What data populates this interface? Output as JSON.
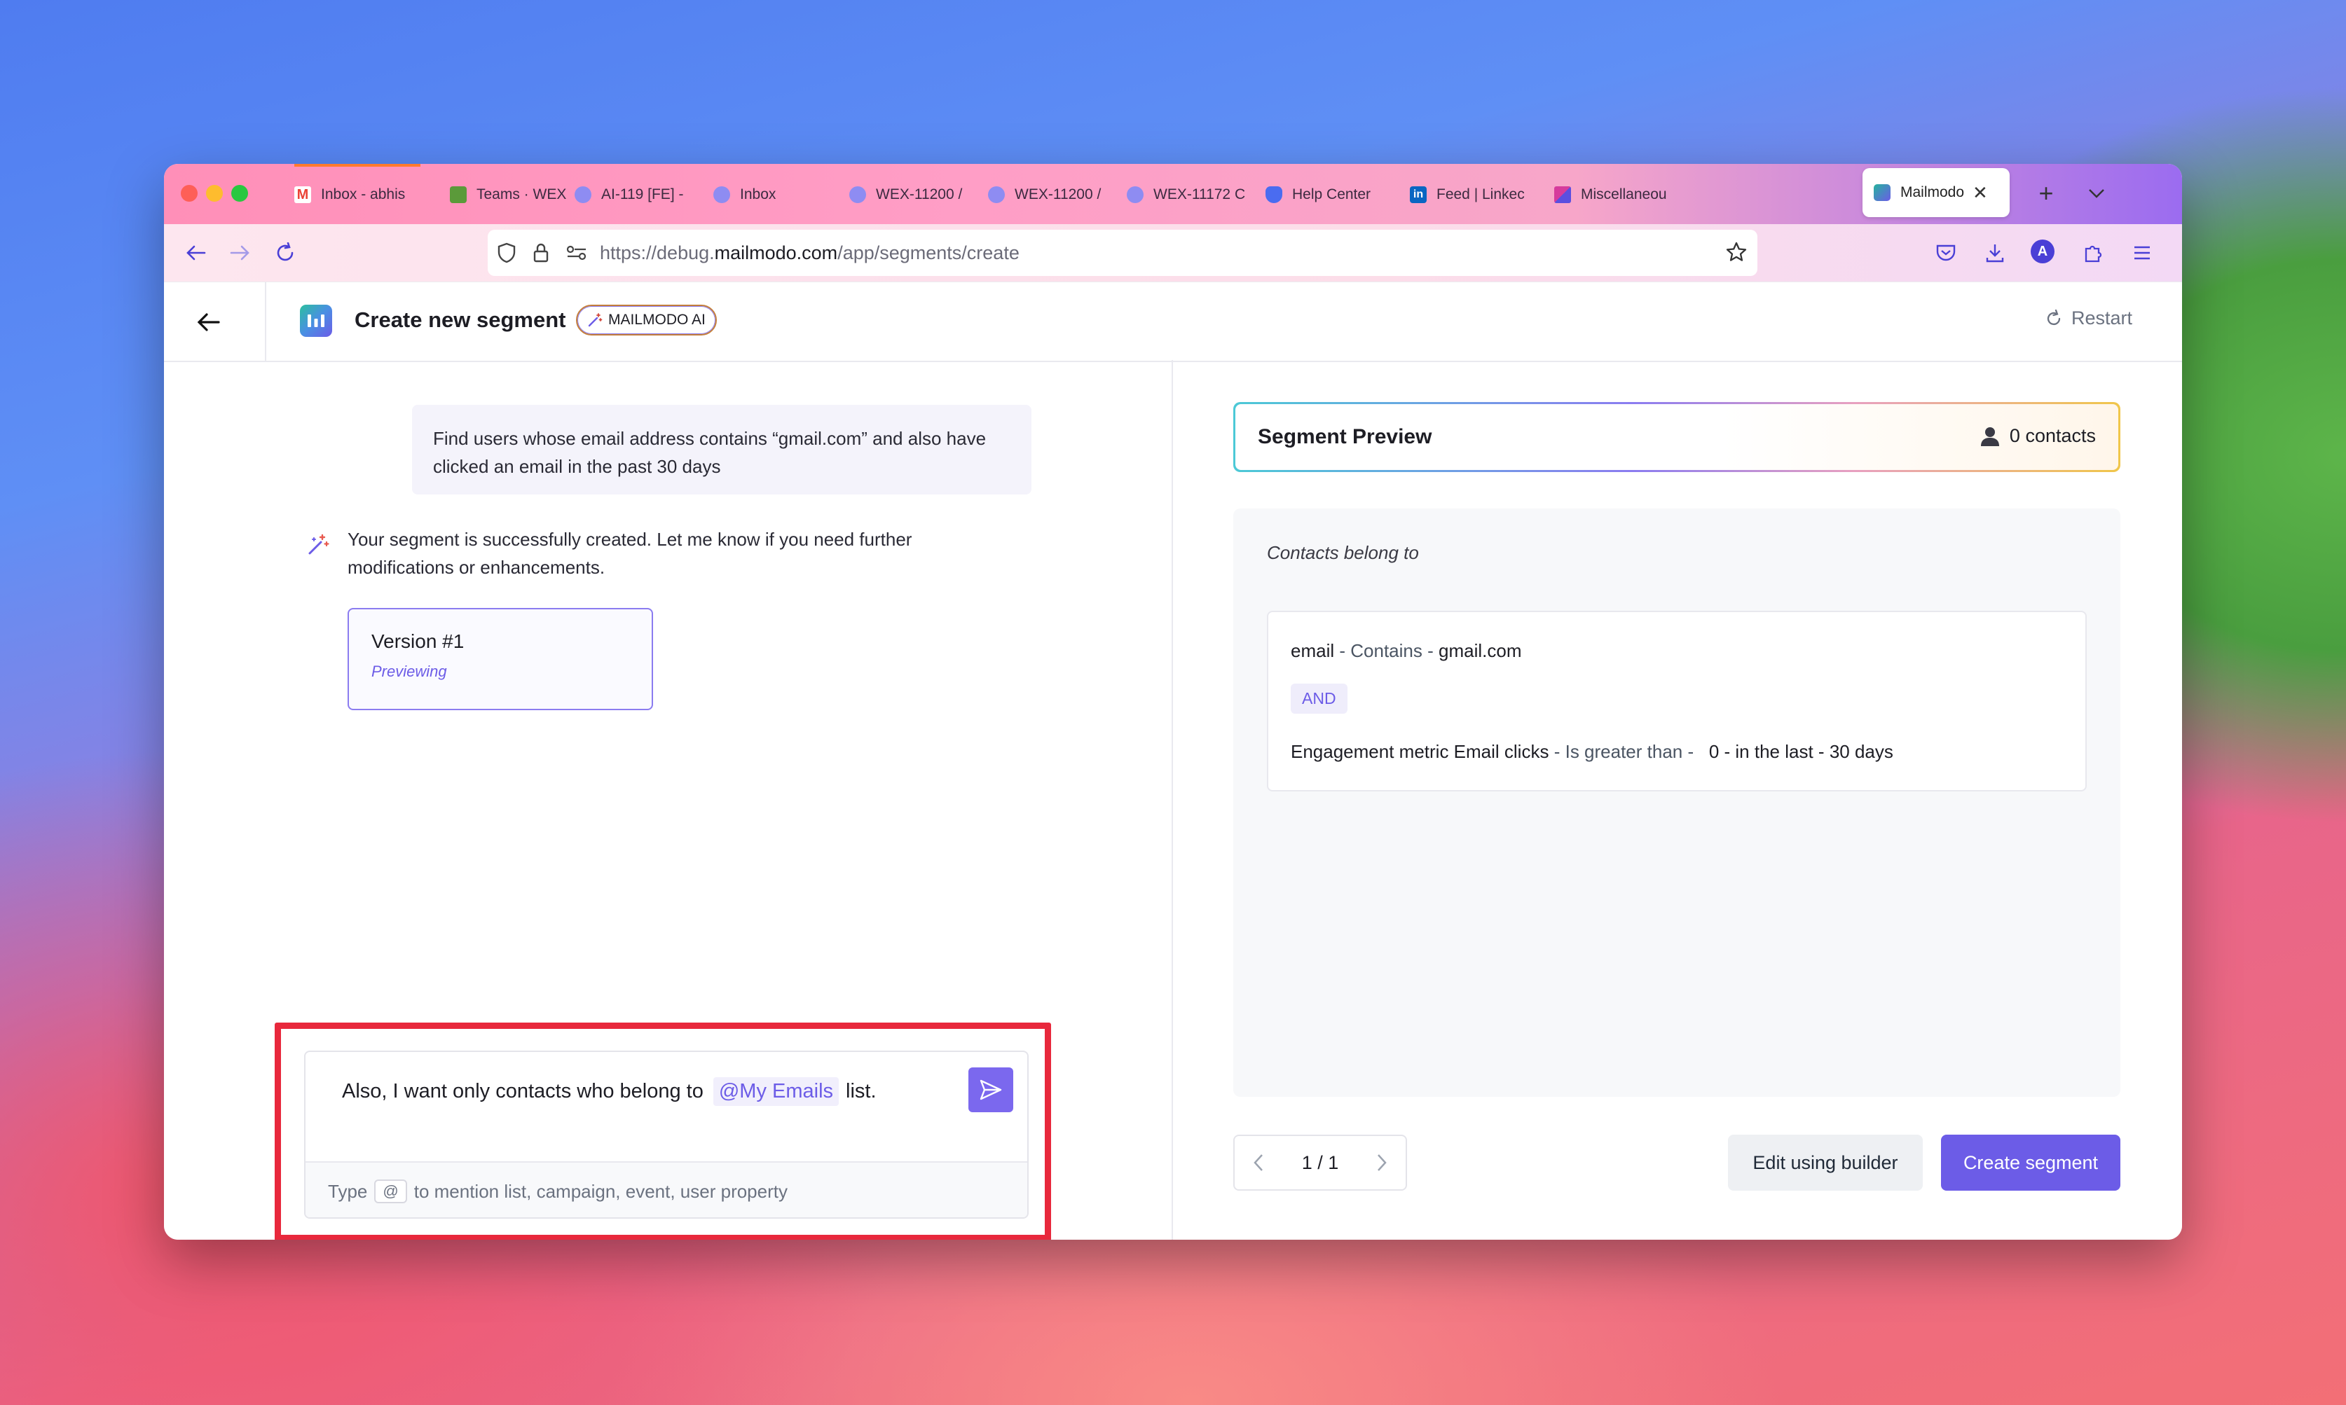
{
  "browser": {
    "tabs": [
      {
        "label": "Inbox - abhis",
        "icon": "gmail-icon"
      },
      {
        "label": "Teams · WEX",
        "icon": "teams-icon"
      },
      {
        "label": "AI-119 [FE] -",
        "icon": "linear-icon"
      },
      {
        "label": "Inbox",
        "icon": "linear-icon"
      },
      {
        "label": "WEX-11200 /",
        "icon": "linear-icon"
      },
      {
        "label": "WEX-11200 /",
        "icon": "linear-icon"
      },
      {
        "label": "WEX-11172 C",
        "icon": "linear-icon"
      },
      {
        "label": "Help Center",
        "icon": "helpcenter-icon"
      },
      {
        "label": "Feed | Linkec",
        "icon": "linkedin-icon"
      },
      {
        "label": "Miscellaneou",
        "icon": "apps-icon"
      },
      {
        "label": "Mailmodo",
        "icon": "mailmodo-icon",
        "active": true
      }
    ],
    "url": {
      "prefix": "https://debug.",
      "domain": "mailmodo.com",
      "path": "/app/segments/create"
    },
    "profile_initial": "A"
  },
  "header": {
    "title": "Create new segment",
    "ai_badge": "MAILMODO AI",
    "restart_label": "Restart"
  },
  "chat": {
    "user_message": "Find users whose email address contains “gmail.com” and also have clicked an email in the past 30 days",
    "ai_message": "Your segment is successfully created. Let me know if you need further modifications or enhancements.",
    "version_card": {
      "title": "Version #1",
      "status": "Previewing"
    },
    "input": {
      "text_before": "Also, I want only contacts who belong to",
      "mention": "@My Emails",
      "text_after": "list.",
      "hint_prefix": "Type",
      "hint_key": "@",
      "hint_suffix": "to mention list, campaign, event, user property"
    }
  },
  "preview": {
    "title": "Segment Preview",
    "contacts_label": "0 contacts",
    "belong_label": "Contacts belong to",
    "condition1": {
      "field": "email",
      "op": "Contains",
      "value": "gmail.com"
    },
    "operator": "AND",
    "condition2": {
      "field": "Engagement metric Email clicks",
      "op": "Is greater than",
      "value": "0",
      "suffix": "in the last",
      "period": "30 days"
    },
    "pagination": "1 / 1",
    "edit_button": "Edit using builder",
    "create_button": "Create segment"
  },
  "colors": {
    "accent": "#6c5ce7",
    "highlight_box": "#e8283c"
  }
}
